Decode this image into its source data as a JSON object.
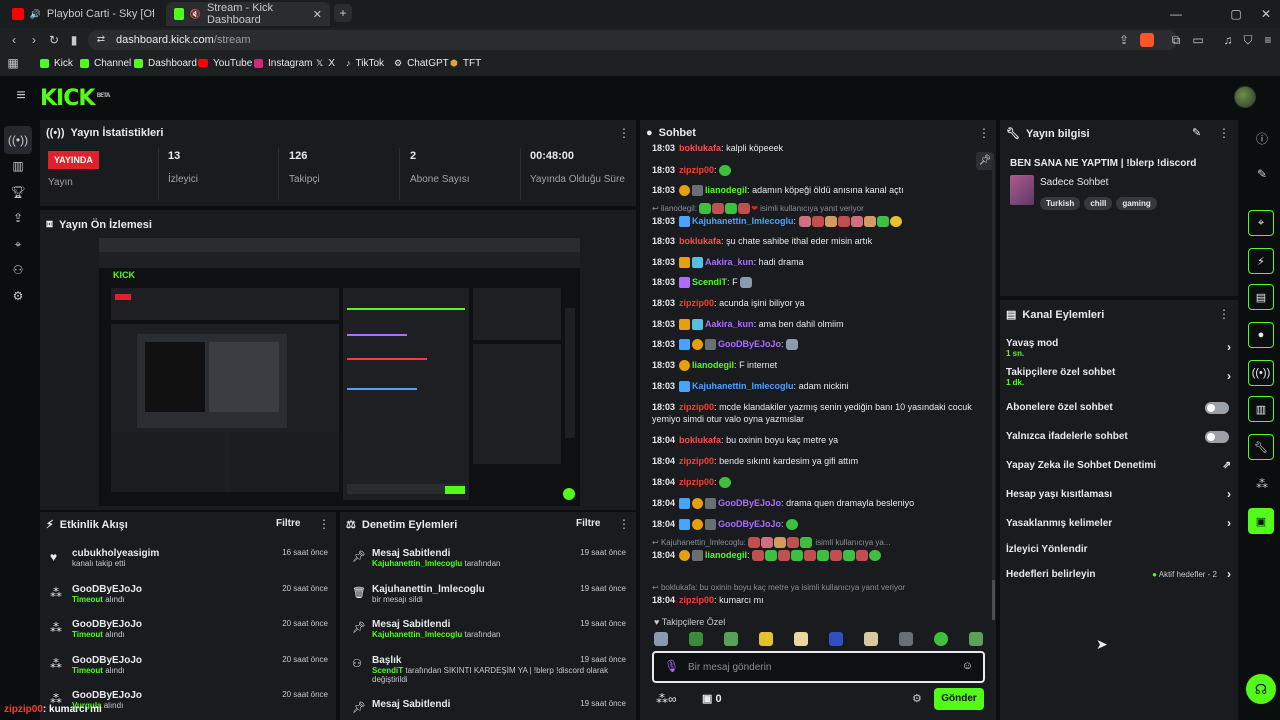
{
  "browser": {
    "tabs": [
      {
        "title": "Playboi Carti - Sky [Official Video]"
      },
      {
        "title": "Stream - Kick Dashboard"
      }
    ],
    "url_host": "dashboard.kick.com",
    "url_path": "/stream",
    "bookmarks": [
      "Kick",
      "Channel",
      "Dashboard",
      "YouTube",
      "Instagram",
      "X",
      "TikTok",
      "ChatGPT",
      "TFT"
    ]
  },
  "brand": {
    "logo": "KICK",
    "beta": "BETA",
    "accent": "#53fc18"
  },
  "stats": {
    "title": "Yayın İstatistikleri",
    "live_badge": "YAYINDA",
    "items": [
      {
        "label": "Yayın",
        "value": ""
      },
      {
        "label": "İzleyici",
        "value": "13"
      },
      {
        "label": "Takipçi",
        "value": "126"
      },
      {
        "label": "Abone Sayısı",
        "value": "2"
      },
      {
        "label": "Yayında Olduğu Süre",
        "value": "00:48:00"
      }
    ]
  },
  "preview": {
    "title": "Yayın Ön İzlemesi"
  },
  "activity": {
    "title": "Etkinlik Akışı",
    "filter": "Filtre",
    "items": [
      {
        "name": "cubukholyeasigim",
        "detail": "kanalı takip etti",
        "accent": "",
        "time": "16 saat önce"
      },
      {
        "name": "GooDByEJoJo",
        "accent": "Timeout",
        "detail": "alındı",
        "time": "20 saat önce"
      },
      {
        "name": "GooDByEJoJo",
        "accent": "Timeout",
        "detail": "alındı",
        "time": "20 saat önce"
      },
      {
        "name": "GooDByEJoJo",
        "accent": "Timeout",
        "detail": "alındı",
        "time": "20 saat önce"
      },
      {
        "name": "GooDByEJoJo",
        "accent": "Vurgula",
        "detail": "alındı",
        "time": "20 saat önce"
      }
    ]
  },
  "moderation": {
    "title": "Denetim Eylemleri",
    "filter": "Filtre",
    "items": [
      {
        "title": "Mesaj Sabitlendi",
        "accent": "Kajuhanettin_lmlecoglu",
        "detail": "tarafından",
        "time": "19 saat önce"
      },
      {
        "title": "Kajuhanettin_lmlecoglu",
        "accent": "",
        "detail": "bir mesajı sildi",
        "time": "19 saat önce"
      },
      {
        "title": "Mesaj Sabitlendi",
        "accent": "Kajuhanettin_lmlecoglu",
        "detail": "tarafından",
        "time": "19 saat önce"
      },
      {
        "title": "Başlık",
        "accent": "ScendiT",
        "detail": "tarafından SIKINTI KARDEŞİM YA | !blerp !discord olarak değiştirildi",
        "time": "19 saat önce"
      },
      {
        "title": "Mesaj Sabitlendi",
        "accent": "",
        "detail": "",
        "time": "19 saat önce"
      }
    ]
  },
  "chat": {
    "title": "Sohbet",
    "messages": [
      {
        "time": "18:03",
        "user": "boklukafa",
        "color": "#ff4d4d",
        "text": "kalpli köpeeek"
      },
      {
        "time": "18:03",
        "user": "zipzip00",
        "color": "#ff3b30",
        "text": ""
      },
      {
        "time": "18:03",
        "user": "lianodegil",
        "color": "#53fc18",
        "text": "adamın köpeği öldü anısına kanal açtı"
      },
      {
        "reply": "lianodegil:",
        "reply_text": "isimli kullanıcıya yanıt veriyor"
      },
      {
        "time": "18:03",
        "user": "Kajuhanettin_lmlecoglu",
        "color": "#4aa3ff",
        "text": ""
      },
      {
        "time": "18:03",
        "user": "boklukafa",
        "color": "#ff4d4d",
        "text": "şu chate sahibe ithal eder misin artık"
      },
      {
        "time": "18:03",
        "user": "Aakira_kun",
        "color": "#b06cff",
        "text": "hadi drama"
      },
      {
        "time": "18:03",
        "user": "ScendiT",
        "color": "#53fc18",
        "text": "F"
      },
      {
        "time": "18:03",
        "user": "zipzip00",
        "color": "#ff3b30",
        "text": "acunda işini biliyor ya"
      },
      {
        "time": "18:03",
        "user": "Aakira_kun",
        "color": "#b06cff",
        "text": "ama ben dahil olmiim"
      },
      {
        "time": "18:03",
        "user": "GooDByEJoJo",
        "color": "#b06cff",
        "text": ""
      },
      {
        "time": "18:03",
        "user": "lianodegil",
        "color": "#53fc18",
        "text": "F internet"
      },
      {
        "time": "18:03",
        "user": "Kajuhanettin_lmlecoglu",
        "color": "#4aa3ff",
        "text": "adam nickini"
      },
      {
        "time": "18:03",
        "user": "zipzip00",
        "color": "#ff3b30",
        "text": "mcde klandakiler yazmış senin yediğin banı 10 yasındaki cocuk yemiyo simdi otur valo oyna yazmıslar"
      },
      {
        "time": "18:04",
        "user": "boklukafa",
        "color": "#ff4d4d",
        "text": "bu oxinin boyu kaç metre ya"
      },
      {
        "time": "18:04",
        "user": "zipzip00",
        "color": "#ff3b30",
        "text": "bende sıkıntı kardesim ya gifi attım"
      },
      {
        "time": "18:04",
        "user": "zipzip00",
        "color": "#ff3b30",
        "text": ""
      },
      {
        "time": "18:04",
        "user": "GooDByEJoJo",
        "color": "#b06cff",
        "text": "drama quen dramayla besleniyo"
      },
      {
        "time": "18:04",
        "user": "GooDByEJoJo",
        "color": "#b06cff",
        "text": ""
      },
      {
        "reply": "Kajuhanettin_lmlecoglu:",
        "reply_text": "isimli kullanıcıya ya..."
      },
      {
        "time": "18:04",
        "user": "lianodegil",
        "color": "#53fc18",
        "text": ""
      },
      {
        "reply": "boklukafa:",
        "reply_text": "bu oxinin boyu kaç metre ya isimli kullanıcıya yanıt veriyor"
      },
      {
        "time": "18:04",
        "user": "zipzip00",
        "color": "#ff3b30",
        "text": "kumarcı mı"
      }
    ],
    "followers_only": "Takipçilere Özel",
    "input_placeholder": "Bir mesaj gönderin",
    "points": "0",
    "send": "Gönder"
  },
  "stream_info": {
    "title": "Yayın bilgisi",
    "stream_title": "BEN SANA NE YAPTIM | !blerp !discord",
    "category": "Sadece Sohbet",
    "tags": [
      "Turkish",
      "chill",
      "gaming"
    ]
  },
  "channel_actions": {
    "title": "Kanal Eylemleri",
    "items": [
      {
        "label": "Yavaş mod",
        "sub": "1 sn.",
        "type": "chevron"
      },
      {
        "label": "Takipçilere özel sohbet",
        "sub": "1 dk.",
        "type": "chevron"
      },
      {
        "label": "Abonelere özel sohbet",
        "sub": "",
        "type": "toggle"
      },
      {
        "label": "Yalnızca ifadelerle sohbet",
        "sub": "",
        "type": "toggle"
      },
      {
        "label": "Yapay Zeka ile Sohbet Denetimi",
        "sub": "",
        "type": "external"
      },
      {
        "label": "Hesap yaşı kısıtlaması",
        "sub": "",
        "type": "chevron"
      },
      {
        "label": "Yasaklanmış kelimeler",
        "sub": "",
        "type": "chevron"
      },
      {
        "label": "İzleyici Yönlendir",
        "sub": "",
        "type": "none"
      },
      {
        "label": "Hedefleri belirleyin",
        "sub": "",
        "type": "chevron",
        "extra": "Aktif hedefler - 2"
      }
    ]
  },
  "overlay": {
    "user": "zipzip00",
    "text": ": kumarcı mı"
  }
}
